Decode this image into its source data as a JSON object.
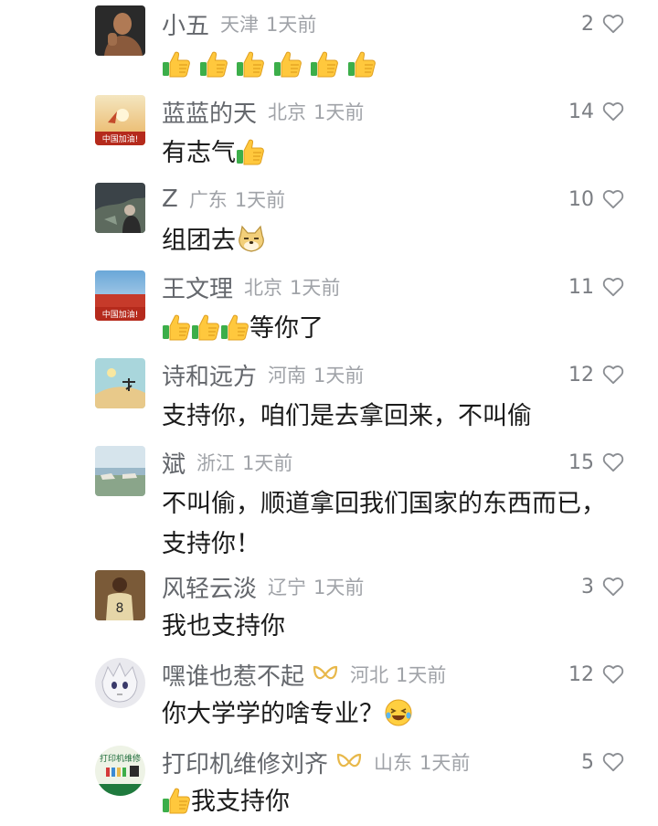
{
  "comments": [
    {
      "nickname": "小五",
      "location": "天津",
      "time": "1天前",
      "likes": "2",
      "text": ""
    },
    {
      "nickname": "蓝蓝的天",
      "location": "北京",
      "time": "1天前",
      "likes": "14",
      "text": "有志气"
    },
    {
      "nickname": "Z",
      "location": "广东",
      "time": "1天前",
      "likes": "10",
      "text": "组团去"
    },
    {
      "nickname": "王文理",
      "location": "北京",
      "time": "1天前",
      "likes": "11",
      "text": "等你了"
    },
    {
      "nickname": "诗和远方",
      "location": "河南",
      "time": "1天前",
      "likes": "12",
      "text": "支持你，咱们是去拿回来，不叫偷"
    },
    {
      "nickname": "斌",
      "location": "浙江",
      "time": "1天前",
      "likes": "15",
      "text": "不叫偷，顺道拿回我们国家的东西而已，",
      "text2": "支持你！"
    },
    {
      "nickname": "风轻云淡",
      "location": "辽宁",
      "time": "1天前",
      "likes": "3",
      "text": "我也支持你"
    },
    {
      "nickname": "嘿谁也惹不起",
      "location": "河北",
      "time": "1天前",
      "likes": "12",
      "text": "你大学学的啥专业？"
    },
    {
      "nickname": "打印机维修刘齐",
      "location": "山东",
      "time": "1天前",
      "likes": "5",
      "text": "我支持你"
    }
  ],
  "avatar_labels": {
    "china_jiayou": "中国加油!",
    "printer_shop": "打印机维修"
  },
  "icons": {
    "like": "heart-outline-icon",
    "thumbs": "thumbs-up-emoji",
    "doge": "doge-emoji",
    "laugh": "laughing-emoji",
    "badge": "fan-badge-icon"
  },
  "colors": {
    "nickname": "#64676c",
    "meta": "#a0a3a8",
    "text": "#1a1a1a",
    "badge": "#e8b84a"
  }
}
